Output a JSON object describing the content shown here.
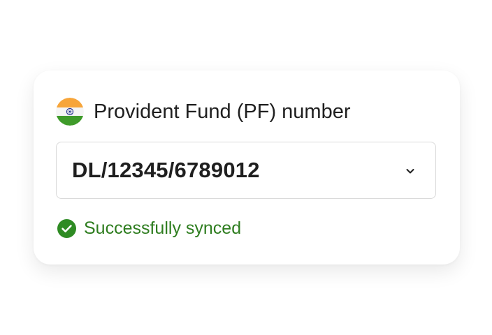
{
  "field": {
    "flag_icon": "india-flag-icon",
    "label": "Provident Fund (PF) number",
    "value": "DL/12345/6789012",
    "dropdown_icon": "chevron-down-icon"
  },
  "status": {
    "icon": "check-circle-icon",
    "text": "Successfully synced",
    "color": "#2e7d1f"
  },
  "colors": {
    "saffron": "#f7a53a",
    "green": "#3f9b2a",
    "chakra": "#1d2b8c"
  }
}
